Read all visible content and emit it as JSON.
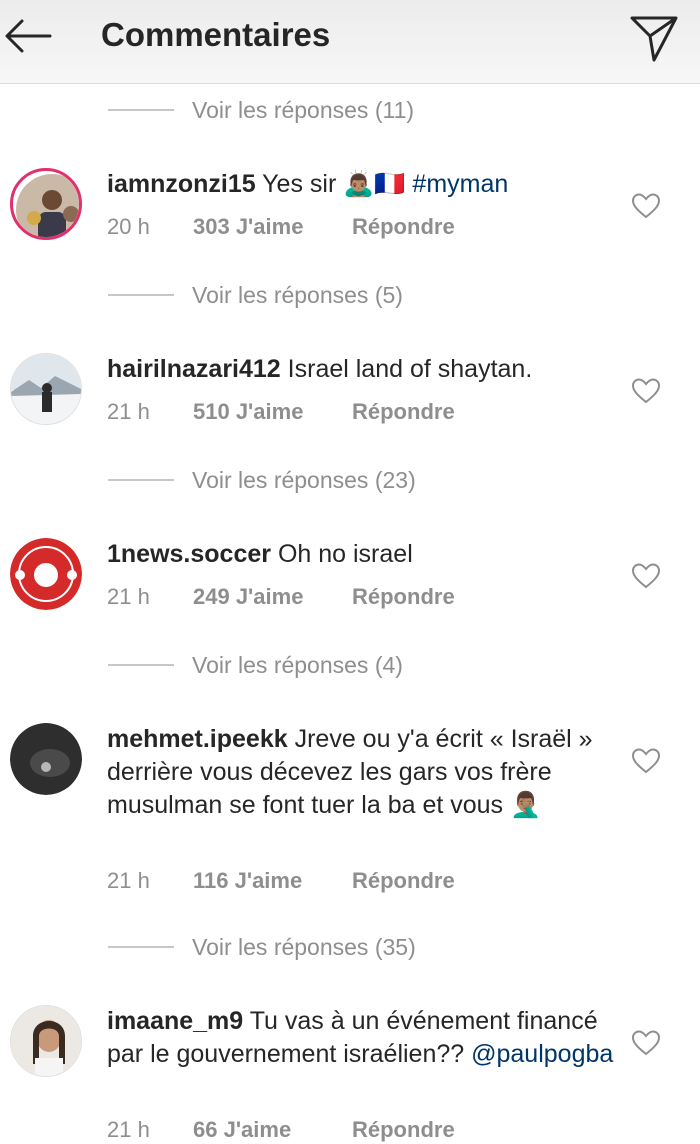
{
  "header": {
    "title": "Commentaires",
    "back_icon": "arrow-left-icon",
    "send_icon": "send-paper-plane-icon"
  },
  "colors": {
    "link": "#003569",
    "muted": "#8e8e8e",
    "text": "#262626",
    "story_ring": "#e1306c"
  },
  "reply_threads": [
    {
      "label": "Voir les réponses (11)"
    },
    {
      "label": "Voir les réponses (5)"
    },
    {
      "label": "Voir les réponses (23)"
    },
    {
      "label": "Voir les réponses (4)"
    },
    {
      "label": "Voir les réponses (35)"
    }
  ],
  "comments": [
    {
      "username": "iamnzonzi15",
      "text": "Yes sir 🙇🏽‍♂️🇫🇷",
      "hashtag": "#myman",
      "time": "20 h",
      "likes": "303 J'aime",
      "reply": "Répondre"
    },
    {
      "username": "hairilnazari412",
      "text": "Israel land of shaytan.",
      "time": "21 h",
      "likes": "510 J'aime",
      "reply": "Répondre"
    },
    {
      "username": "1news.soccer",
      "text": "Oh no israel",
      "time": "21 h",
      "likes": "249 J'aime",
      "reply": "Répondre"
    },
    {
      "username": "mehmet.ipeekk",
      "text": "Jreve ou y'a écrit « Israël » derrière vous décevez les gars vos frère musulman se font tuer la ba et vous 🤦🏽‍♂️",
      "time": "21 h",
      "likes": "116 J'aime",
      "reply": "Répondre"
    },
    {
      "username": "imaane_m9",
      "text": "Tu vas à un événement financé par le gouvernement israélien??",
      "mention": "@paulpogba",
      "time": "21 h",
      "likes": "66 J'aime",
      "reply": "Répondre"
    }
  ]
}
